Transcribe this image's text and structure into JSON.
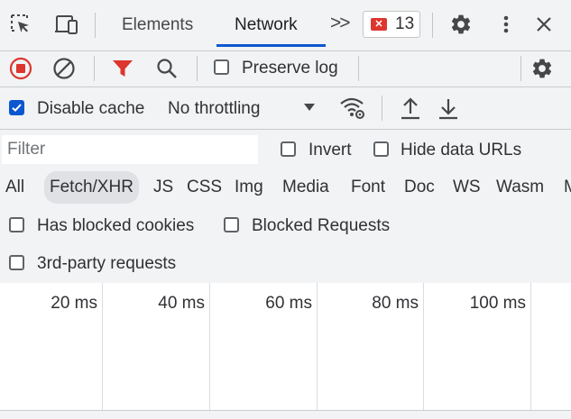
{
  "tabbar": {
    "tabs": [
      {
        "label": "Elements"
      },
      {
        "label": "Network"
      }
    ],
    "more_tabs": ">>",
    "error_count": "13"
  },
  "toolbar1": {
    "preserve_log": {
      "label": "Preserve log",
      "checked": false
    }
  },
  "toolbar2": {
    "disable_cache": {
      "label": "Disable cache",
      "checked": true
    },
    "throttling": {
      "value": "No throttling"
    }
  },
  "filter": {
    "placeholder": "Filter",
    "value": "",
    "invert": {
      "label": "Invert",
      "checked": false
    },
    "hide_data_urls": {
      "label": "Hide data URLs",
      "checked": false
    }
  },
  "types": [
    "All",
    "Fetch/XHR",
    "JS",
    "CSS",
    "Img",
    "Media",
    "Font",
    "Doc",
    "WS",
    "Wasm",
    "M"
  ],
  "selected_type": "Fetch/XHR",
  "blocked": {
    "has_blocked_cookies": {
      "label": "Has blocked cookies",
      "checked": false
    },
    "blocked_requests": {
      "label": "Blocked Requests",
      "checked": false
    }
  },
  "third_party": {
    "label": "3rd-party requests",
    "checked": false
  },
  "timeline": {
    "ticks": [
      "20 ms",
      "40 ms",
      "60 ms",
      "80 ms",
      "100 ms"
    ]
  },
  "colors": {
    "accent": "#0b57d0",
    "record_red": "#dc362e",
    "filter_red": "#dc362e"
  }
}
